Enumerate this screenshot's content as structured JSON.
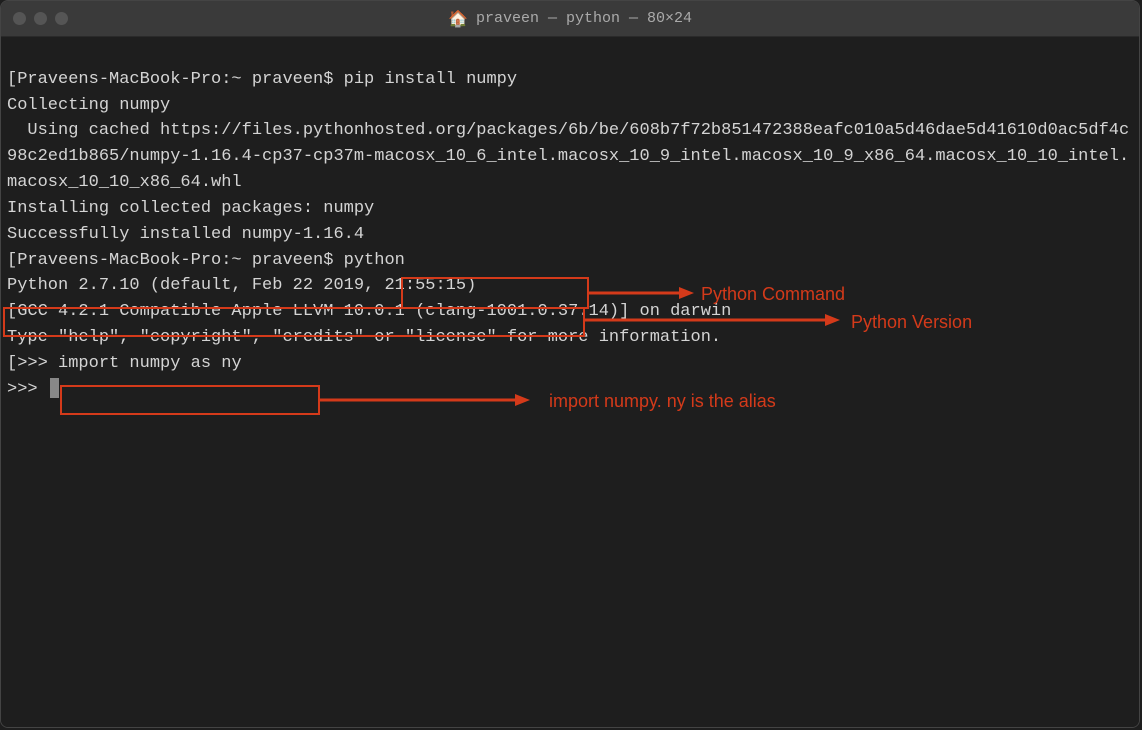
{
  "window": {
    "title": "praveen — python — 80×24"
  },
  "terminal": {
    "line1_prompt": "[Praveens-MacBook-Pro:~ praveen$ ",
    "line1_cmd": "pip install numpy",
    "line2": "Collecting numpy",
    "line3": "  Using cached https://files.pythonhosted.org/packages/6b/be/608b7f72b851472388eafc010a5d46dae5d41610d0ac5df4c98c2ed1b865/numpy-1.16.4-cp37-cp37m-macosx_10_6_intel.macosx_10_9_intel.macosx_10_9_x86_64.macosx_10_10_intel.macosx_10_10_x86_64.whl",
    "line4": "Installing collected packages: numpy",
    "line5": "Successfully installed numpy-1.16.4",
    "line6_prompt": "[Praveens-MacBook-Pro:~ praveen$ ",
    "line6_cmd": "python",
    "line7": "Python 2.7.10 (default, Feb 22 2019, 21:55:15)",
    "line8": "[GCC 4.2.1 Compatible Apple LLVM 10.0.1 (clang-1001.0.37.14)] on darwin",
    "line9": "Type \"help\", \"copyright\", \"credits\" or \"license\" for more information.",
    "line10_prompt": "[>>> ",
    "line10_cmd": "import numpy as ny",
    "line11_prompt": ">>> "
  },
  "annotations": {
    "python_command": "Python Command",
    "python_version": "Python Version",
    "import_numpy": "import numpy. ny is the alias"
  }
}
